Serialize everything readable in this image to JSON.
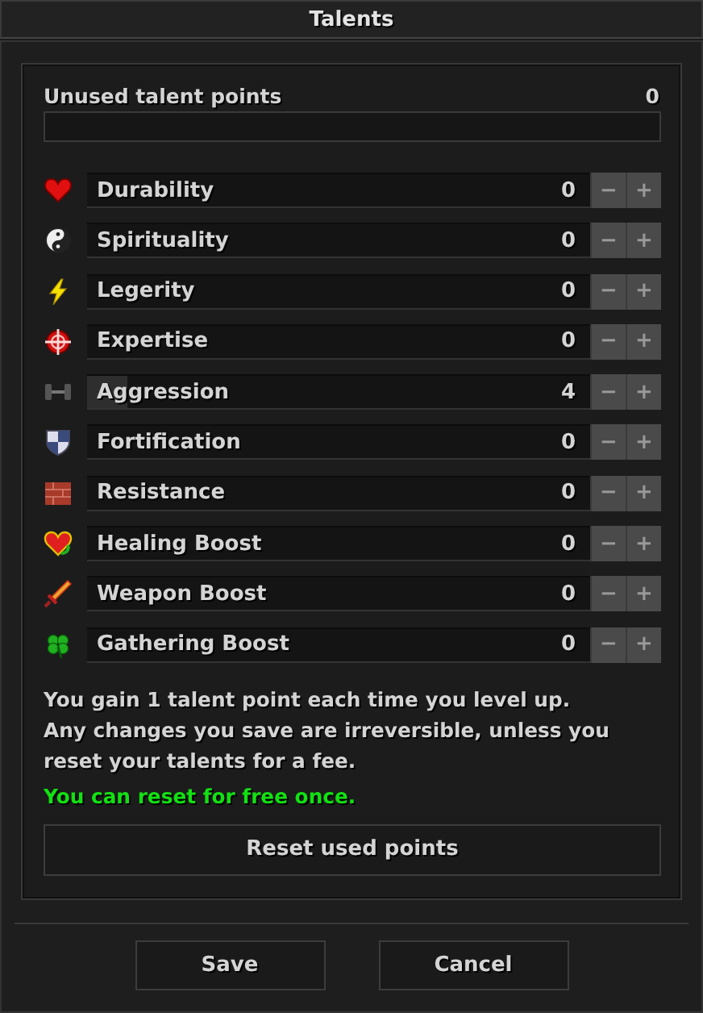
{
  "window": {
    "title": "Talents"
  },
  "unused": {
    "label": "Unused talent points",
    "value": "0"
  },
  "talents": [
    {
      "kind": "heart",
      "name": "Durability",
      "value": "0",
      "minus": "−",
      "plus": "+"
    },
    {
      "kind": "yinyang",
      "name": "Spirituality",
      "value": "0",
      "minus": "−",
      "plus": "+"
    },
    {
      "kind": "bolt",
      "name": "Legerity",
      "value": "0",
      "minus": "−",
      "plus": "+"
    },
    {
      "kind": "crosshair",
      "name": "Expertise",
      "value": "0",
      "minus": "−",
      "plus": "+"
    },
    {
      "kind": "dumbbell",
      "name": "Aggression",
      "value": "4",
      "level": 0.08,
      "minus": "−",
      "plus": "+"
    },
    {
      "kind": "shield",
      "name": "Fortification",
      "value": "0",
      "minus": "−",
      "plus": "+"
    },
    {
      "kind": "brick",
      "name": "Resistance",
      "value": "0",
      "minus": "−",
      "plus": "+"
    },
    {
      "kind": "healheart",
      "name": "Healing Boost",
      "value": "0",
      "minus": "−",
      "plus": "+"
    },
    {
      "kind": "sword",
      "name": "Weapon Boost",
      "value": "0",
      "minus": "−",
      "plus": "+"
    },
    {
      "kind": "clover",
      "name": "Gathering Boost",
      "value": "0",
      "minus": "−",
      "plus": "+"
    }
  ],
  "info": [
    "You gain 1 talent point each time you level up.",
    "Any changes you save are irreversible, unless you reset your talents for a fee."
  ],
  "notice": "You can reset for free once.",
  "reset_button": "Reset used points",
  "buttons": [
    "Save",
    "Cancel"
  ]
}
